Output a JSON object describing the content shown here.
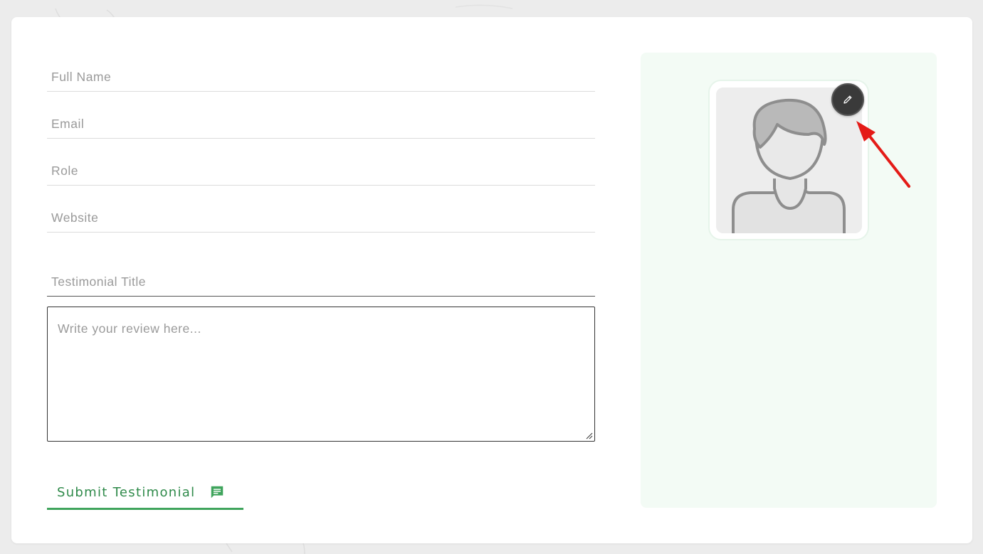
{
  "form": {
    "full_name_placeholder": "Full Name",
    "email_placeholder": "Email",
    "role_placeholder": "Role",
    "website_placeholder": "Website",
    "title_placeholder": "Testimonial Title",
    "review_placeholder": "Write your review here..."
  },
  "submit": {
    "label": "Submit Testimonial",
    "icon": "comment-icon"
  },
  "avatar": {
    "image": "default-user-avatar",
    "edit_icon": "pencil-icon"
  },
  "annotation": {
    "type": "arrow",
    "color": "#e41b17"
  },
  "colors": {
    "accent_green": "#3fa45c",
    "panel_bg": "#f3fbf5",
    "edit_button_bg": "#3a3a3a"
  }
}
